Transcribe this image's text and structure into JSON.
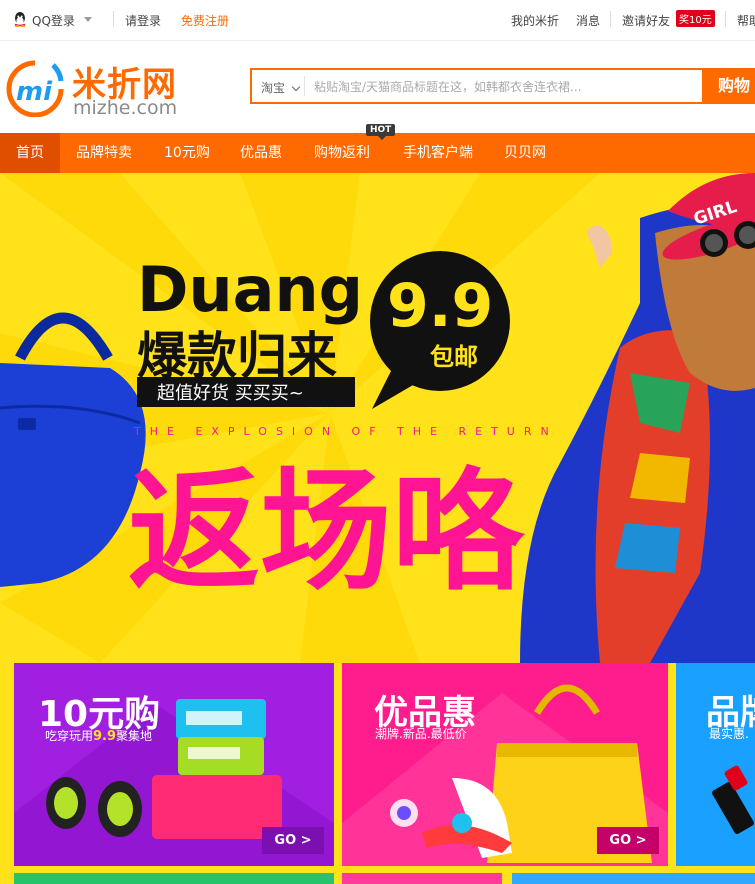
{
  "topbar": {
    "qq_login": "QQ登录",
    "login": "请登录",
    "register": "免费注册",
    "my_mizhe": "我的米折",
    "messages": "消息",
    "invite": "邀请好友",
    "invite_badge": "奖10元",
    "help": "帮助"
  },
  "header": {
    "logo_cn": "米折网",
    "logo_en": "mizhe.com",
    "search_source": "淘宝",
    "search_placeholder": "粘贴淘宝/天猫商品标题在这，如韩都衣舍连衣裙...",
    "search_button": "购物"
  },
  "nav": {
    "tabs": [
      "首页",
      "品牌特卖",
      "10元购",
      "优品惠",
      "购物返利",
      "手机客户端",
      "贝贝网"
    ],
    "hot_badge": "HOT",
    "active_index": 0
  },
  "banner": {
    "headline_en": "Duang",
    "headline_cn": "爆款归来",
    "tagline": "超值好货 买买买~",
    "price": "9.9",
    "price_note": "包邮",
    "subtitle_en": "THE EXPLOSION OF THE RETURN",
    "big_text": "返场咯",
    "cap_text": "GIRL"
  },
  "promos": [
    {
      "title": "10元购",
      "subtitle_pre": "吃穿玩用",
      "subtitle_hl": "9.9",
      "subtitle_post": "聚集地",
      "go": "GO >",
      "color": "#a11fe0"
    },
    {
      "title": "优品惠",
      "subtitle": "潮牌.新品.最低价",
      "go": "GO >",
      "color": "#ff1c8d"
    },
    {
      "title": "品牌",
      "subtitle": "最实惠.",
      "color": "#1aa0ff"
    }
  ],
  "colors": {
    "brand": "#ff6a00",
    "banner_bg": "#ffe21a",
    "magenta": "#ff1493"
  }
}
